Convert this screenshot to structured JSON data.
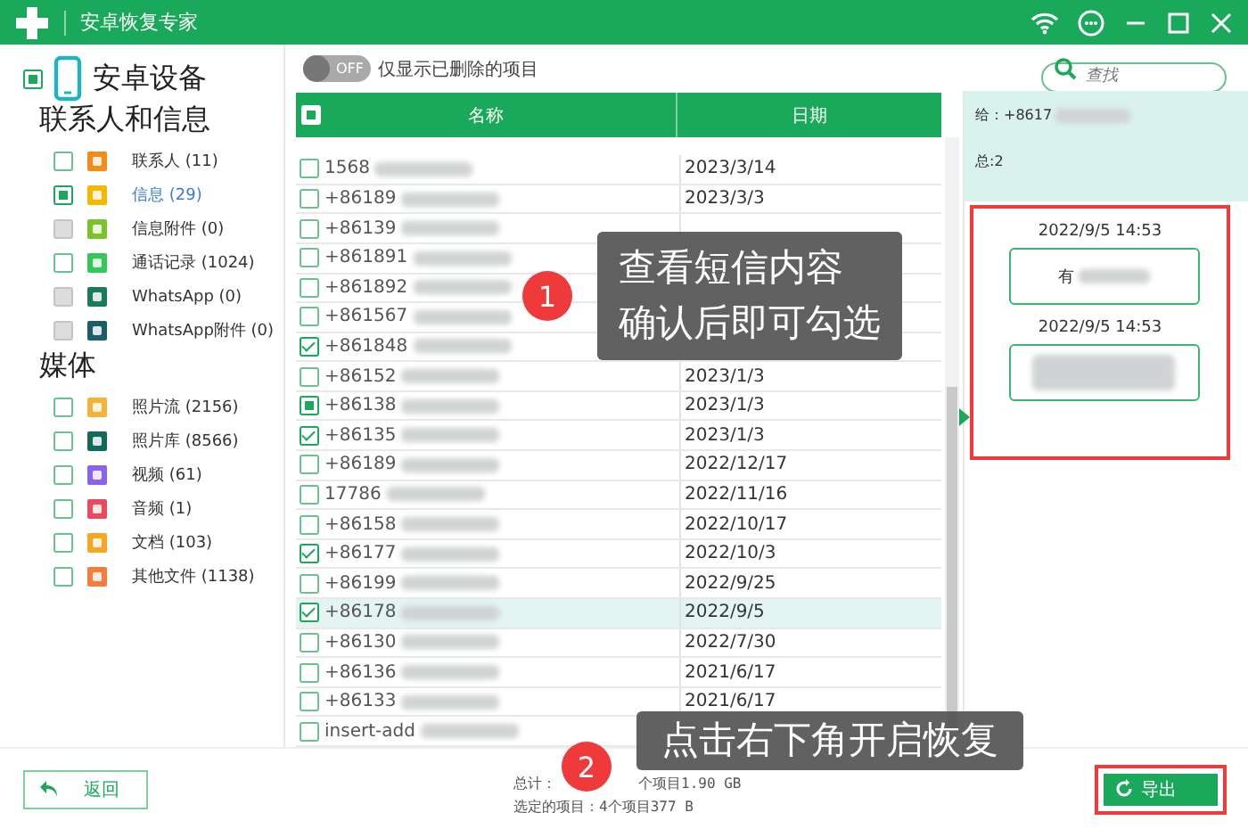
{
  "window": {
    "title": "安卓恢复专家"
  },
  "sidebar": {
    "device": {
      "label": "安卓设备",
      "checked": true,
      "partial": true
    },
    "groups": [
      {
        "title": "联系人和信息",
        "items": [
          {
            "label": "联系人 (11)",
            "checked": false,
            "partial": false,
            "disabled": false,
            "selected": false,
            "kind": "contact"
          },
          {
            "label": "信息 (29)",
            "checked": true,
            "partial": true,
            "disabled": false,
            "selected": true,
            "kind": "message"
          },
          {
            "label": "信息附件 (0)",
            "checked": false,
            "partial": false,
            "disabled": true,
            "selected": false,
            "kind": "attach"
          },
          {
            "label": "通话记录 (1024)",
            "checked": false,
            "partial": false,
            "disabled": false,
            "selected": false,
            "kind": "phone"
          },
          {
            "label": "WhatsApp (0)",
            "checked": false,
            "partial": false,
            "disabled": true,
            "selected": false,
            "kind": "whatsapp"
          },
          {
            "label": "WhatsApp附件 (0)",
            "checked": false,
            "partial": false,
            "disabled": true,
            "selected": false,
            "kind": "whatsattach"
          }
        ]
      },
      {
        "title": "媒体",
        "items": [
          {
            "label": "照片流 (2156)",
            "checked": false,
            "partial": false,
            "disabled": false,
            "selected": false,
            "kind": "star"
          },
          {
            "label": "照片库 (8566)",
            "checked": false,
            "partial": false,
            "disabled": false,
            "selected": false,
            "kind": "image"
          },
          {
            "label": "视频 (61)",
            "checked": false,
            "partial": false,
            "disabled": false,
            "selected": false,
            "kind": "video"
          },
          {
            "label": "音频 (1)",
            "checked": false,
            "partial": false,
            "disabled": false,
            "selected": false,
            "kind": "audio"
          },
          {
            "label": "文档 (103)",
            "checked": false,
            "partial": false,
            "disabled": false,
            "selected": false,
            "kind": "folder"
          },
          {
            "label": "其他文件 (1138)",
            "checked": false,
            "partial": false,
            "disabled": false,
            "selected": false,
            "kind": "file"
          }
        ]
      }
    ]
  },
  "toggle": {
    "on": false,
    "label": "OFF",
    "text": "仅显示已删除的项目"
  },
  "search": {
    "placeholder": "查找"
  },
  "table": {
    "columns": [
      "名称",
      "日期"
    ],
    "header_partial": true,
    "rows": [
      {
        "name": "1568",
        "date": "2023/3/14",
        "checked": false,
        "partial": false,
        "selected": false
      },
      {
        "name": "+86189",
        "date": "2023/3/3",
        "checked": false,
        "partial": false,
        "selected": false
      },
      {
        "name": "+86139",
        "checked": false,
        "partial": false,
        "selected": false
      },
      {
        "name": "+861891",
        "checked": false,
        "partial": false,
        "selected": false
      },
      {
        "name": "+861892",
        "checked": false,
        "partial": false,
        "selected": false
      },
      {
        "name": "+861567",
        "checked": false,
        "partial": false,
        "selected": false
      },
      {
        "name": "+861848",
        "checked": true,
        "partial": false,
        "selected": false
      },
      {
        "name": "+86152",
        "date": "2023/1/3",
        "checked": false,
        "partial": false,
        "selected": false
      },
      {
        "name": "+86138",
        "date": "2023/1/3",
        "checked": true,
        "partial": true,
        "selected": false
      },
      {
        "name": "+86135",
        "date": "2023/1/3",
        "checked": true,
        "partial": false,
        "selected": false
      },
      {
        "name": "+86189",
        "date": "2022/12/17",
        "checked": false,
        "partial": false,
        "selected": false
      },
      {
        "name": "17786",
        "date": "2022/11/16",
        "checked": false,
        "partial": false,
        "selected": false
      },
      {
        "name": "+86158",
        "date": "2022/10/17",
        "checked": false,
        "partial": false,
        "selected": false
      },
      {
        "name": "+86177",
        "date": "2022/10/3",
        "checked": true,
        "partial": false,
        "selected": false
      },
      {
        "name": "+86199",
        "date": "2022/9/25",
        "checked": false,
        "partial": false,
        "selected": false
      },
      {
        "name": "+86178",
        "date": "2022/9/5",
        "checked": true,
        "partial": false,
        "selected": true
      },
      {
        "name": "+86130",
        "date": "2022/7/30",
        "checked": false,
        "partial": false,
        "selected": false
      },
      {
        "name": "+86136",
        "date": "2021/6/17",
        "checked": false,
        "partial": false,
        "selected": false
      },
      {
        "name": "+86133",
        "date": "2021/6/17",
        "checked": false,
        "partial": false,
        "selected": false
      },
      {
        "name": "insert-add",
        "checked": false,
        "partial": false,
        "selected": false
      }
    ]
  },
  "detail": {
    "to": "给：+8617",
    "total": "总:2",
    "messages": [
      {
        "time": "2022/9/5 14:53",
        "text": "有"
      },
      {
        "time": "2022/9/5 14:53"
      }
    ]
  },
  "callouts": [
    {
      "number": "1",
      "lines": [
        "查看短信内容",
        "确认后即可勾选"
      ]
    },
    {
      "number": "2",
      "lines": [
        "点击右下角开启恢复"
      ]
    }
  ],
  "footer": {
    "back": "返回",
    "total_label": "总计：",
    "total_rest": "个项目1.90 GB",
    "selected": "选定的项目：4个项目377 B",
    "export": "导出"
  }
}
